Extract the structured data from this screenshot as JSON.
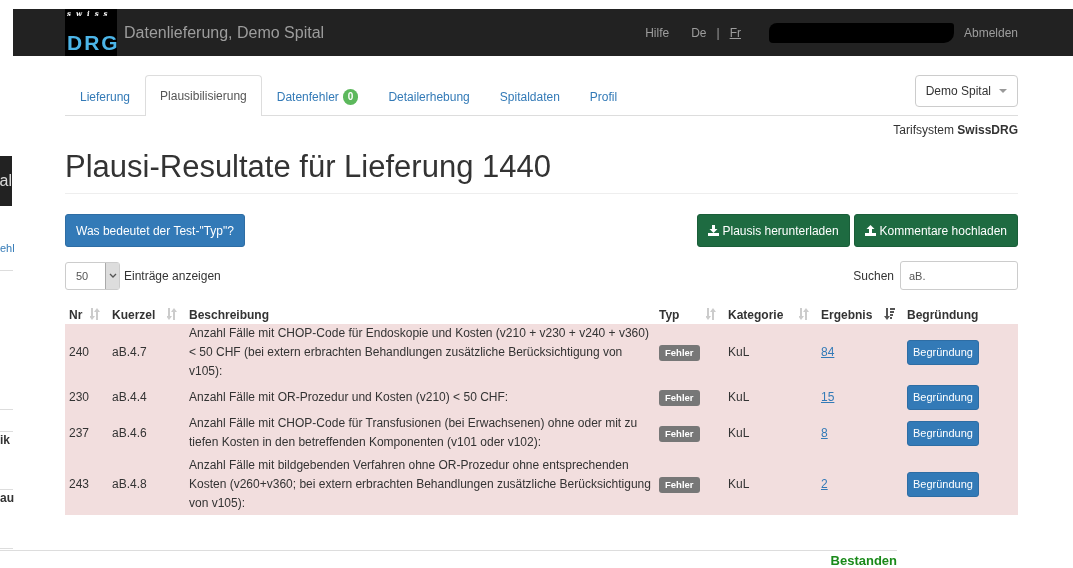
{
  "left_edge": [
    {
      "kind": "dark",
      "text": "al"
    },
    {
      "kind": "link",
      "text": "ehl"
    },
    {
      "kind": "bold",
      "text": "ik"
    },
    {
      "kind": "bold",
      "text": "au"
    }
  ],
  "navbar": {
    "logo_small": "swiss",
    "logo_large": "DRG",
    "title": "Datenlieferung, Demo Spital",
    "help": "Hilfe",
    "languages": [
      {
        "label": "De",
        "selected": true
      },
      {
        "label": "Fr",
        "selected": false
      }
    ],
    "separator": "|",
    "logout": "Abmelden"
  },
  "tabs": [
    {
      "label": "Lieferung",
      "selected": false
    },
    {
      "label": "Plausibilisierung",
      "selected": true
    },
    {
      "label": "Datenfehler",
      "selected": false,
      "badge": "0"
    },
    {
      "label": "Detailerhebung",
      "selected": false
    },
    {
      "label": "Spitaldaten",
      "selected": false
    },
    {
      "label": "Profil",
      "selected": false
    }
  ],
  "hospital_dropdown": "Demo Spital",
  "tariff_system": "Tarifsystem **SwissDRG**",
  "heading": "Plausi-Resultate für Lieferung 1440",
  "info_button": "Was bedeutet der Test-\"Typ\"?",
  "actions": [
    {
      "label": "Plausis herunterladen",
      "kind": "download"
    },
    {
      "label": "Kommentare hochladen",
      "kind": "upload"
    }
  ],
  "page_length": {
    "value": "50",
    "label": "Einträge anzeigen"
  },
  "search": {
    "label": "Suchen",
    "value": "aB."
  },
  "table": {
    "columns": [
      {
        "label": "Nr",
        "sortable": true,
        "sorted": false
      },
      {
        "label": "Kuerzel",
        "sortable": true,
        "sorted": false
      },
      {
        "label": "Beschreibung",
        "sortable": false
      },
      {
        "label": "Typ",
        "sortable": true,
        "sorted": false
      },
      {
        "label": "Kategorie",
        "sortable": true,
        "sorted": false
      },
      {
        "label": "Ergebnis",
        "sortable": true,
        "sorted": true
      },
      {
        "label": "Begründung",
        "sortable": false
      }
    ],
    "rows": [
      {
        "nr": "240",
        "code": "aB.4.7",
        "description": "Anzahl Fälle mit CHOP-Code für Endoskopie und Kosten (v210 + v230 + v240 + v360) < 50 CHF (bei extern erbrachten Behandlungen zusätzliche Berücksichtigung von v105):",
        "type": "Fehler",
        "category": "KuL",
        "result": "84",
        "action": "Begründung"
      },
      {
        "nr": "230",
        "code": "aB.4.4",
        "description": "Anzahl Fälle mit OR-Prozedur und Kosten (v210) < 50 CHF:",
        "type": "Fehler",
        "category": "KuL",
        "result": "15",
        "action": "Begründung"
      },
      {
        "nr": "237",
        "code": "aB.4.6",
        "description": "Anzahl Fälle mit CHOP-Code für Transfusionen (bei Erwachsenen) ohne oder mit zu tiefen Kosten in den betreffenden Komponenten (v101 oder v102):",
        "type": "Fehler",
        "category": "KuL",
        "result": "8",
        "action": "Begründung"
      },
      {
        "nr": "243",
        "code": "aB.4.8",
        "description": "Anzahl Fälle mit bildgebenden Verfahren ohne OR-Prozedur ohne entsprechenden Kosten (v260+v360; bei extern erbrachten Behandlungen zusätzliche Berücksichtigung von v105):",
        "type": "Fehler",
        "category": "KuL",
        "result": "2",
        "action": "Begründung"
      }
    ]
  },
  "footer_status": "Bestanden"
}
